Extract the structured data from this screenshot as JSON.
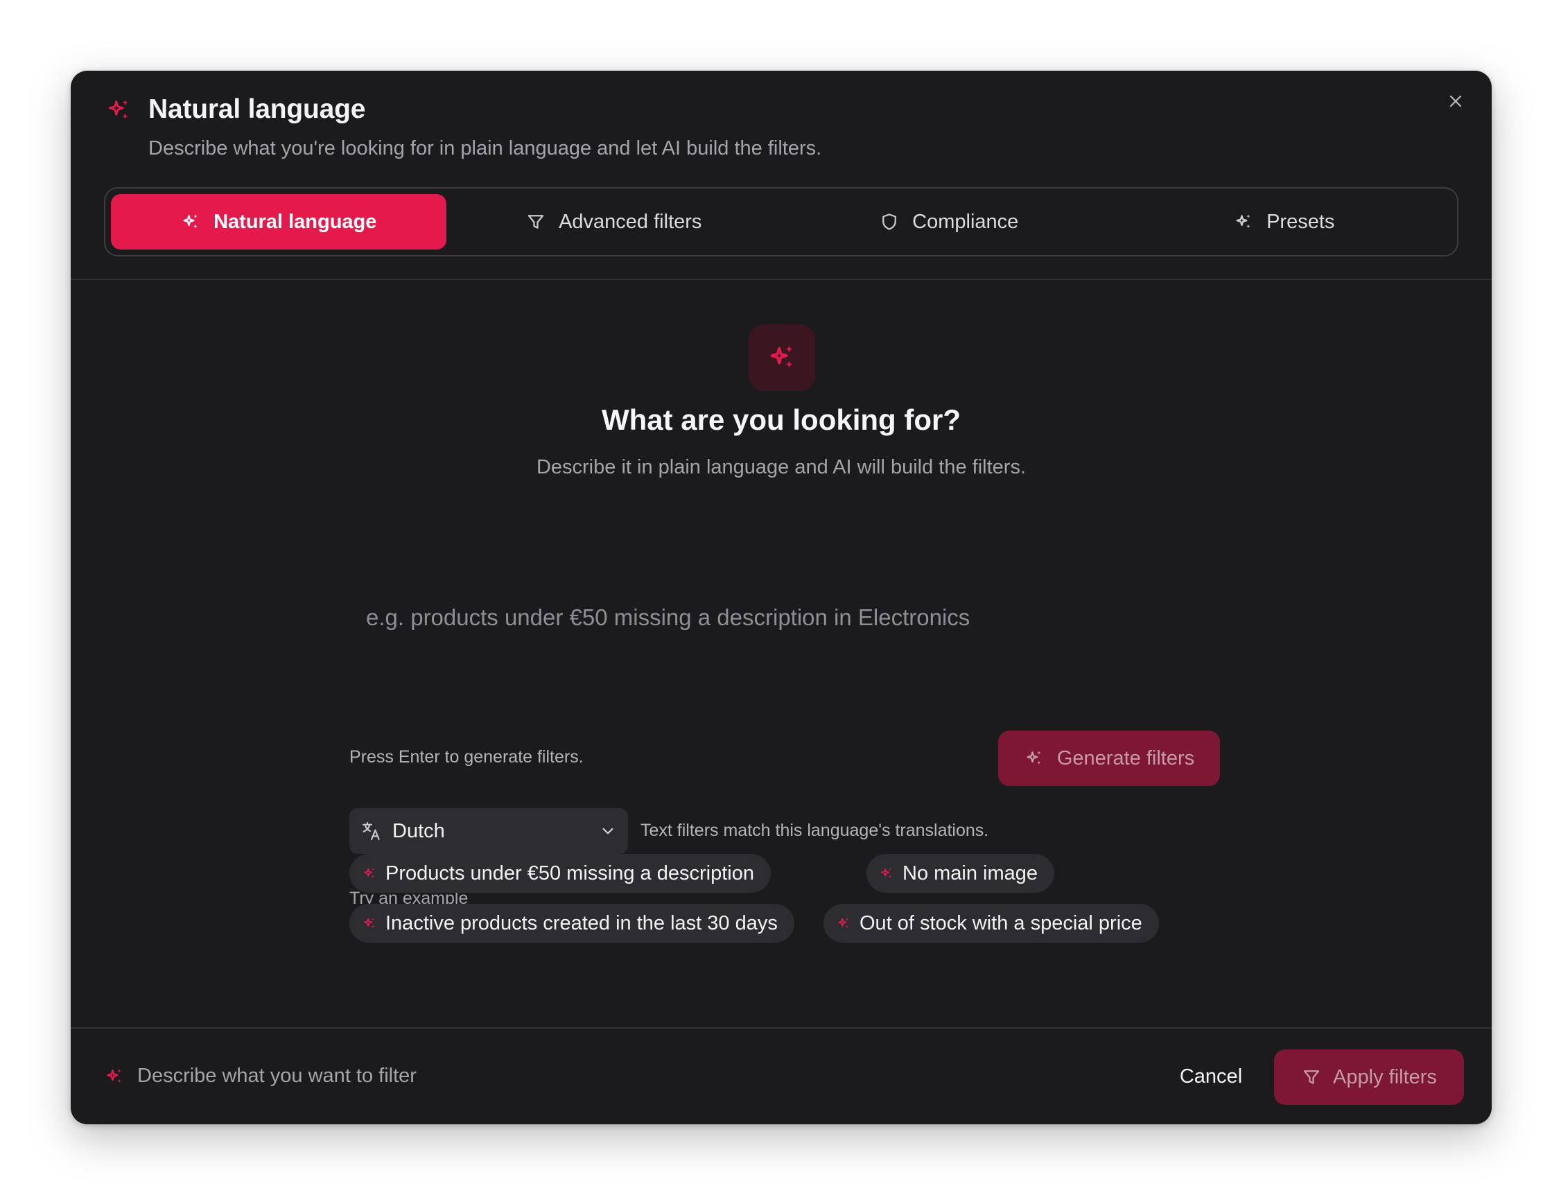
{
  "dialog": {
    "title": "Natural language",
    "subtitle": "Describe what you're looking for in plain language and let AI build the filters.",
    "close_icon": "close-icon"
  },
  "tabs": [
    {
      "label": "Natural language",
      "icon": "sparkles-icon",
      "active": true
    },
    {
      "label": "Advanced filters",
      "icon": "filter-icon",
      "active": false
    },
    {
      "label": "Compliance",
      "icon": "shield-icon",
      "active": false
    },
    {
      "label": "Presets",
      "icon": "sparkles-icon",
      "active": false
    }
  ],
  "hero": {
    "icon": "sparkles-icon",
    "title": "What are you looking for?",
    "subtitle": "Describe it in plain language and AI will build the filters."
  },
  "query": {
    "value": "",
    "placeholder": "e.g. products under €50 missing a description in Electronics"
  },
  "hint": "Press Enter to generate filters.",
  "generate_button": {
    "label": "Generate filters",
    "icon": "sparkles-icon"
  },
  "language": {
    "icon": "translate-icon",
    "selected": "Dutch",
    "help": "Text filters match this language's translations."
  },
  "examples": {
    "label": "Try an example",
    "items": [
      "Products under €50 missing a description",
      "No main image",
      "Inactive products created in the last 30 days",
      "Out of stock with a special price"
    ]
  },
  "footer": {
    "status": "Describe what you want to filter",
    "cancel_label": "Cancel",
    "apply_label": "Apply filters"
  },
  "colors": {
    "accent": "#e51a4c",
    "accent_disabled": "#7d1733",
    "background": "#1b1b1e",
    "surface": "#2c2c31"
  }
}
